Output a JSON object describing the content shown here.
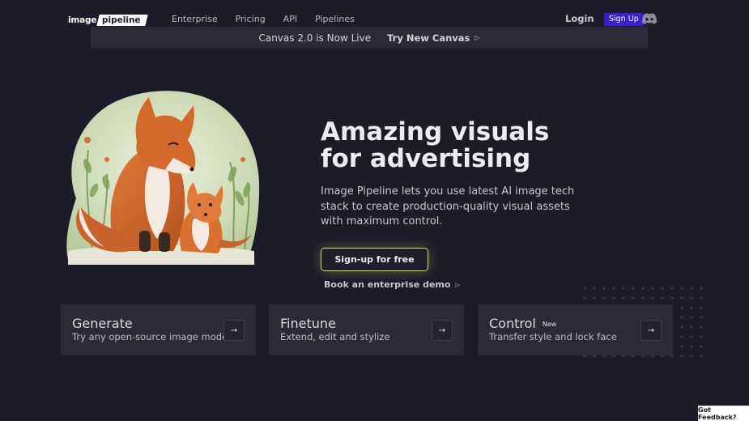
{
  "brand": {
    "logo_word1": "image",
    "logo_word2": "pipeline"
  },
  "nav": {
    "links": [
      "Enterprise",
      "Pricing",
      "API",
      "Pipelines"
    ],
    "login": "Login",
    "signup": "Sign Up",
    "discord_icon": "discord-icon"
  },
  "banner": {
    "text": "Canvas 2.0 is Now Live",
    "link": "Try New Canvas",
    "arrow": "▷"
  },
  "hero": {
    "title": "Amazing visuals for advertising",
    "description": "Image Pipeline lets you use latest AI image tech stack to create production-quality visual assets with maximum control.",
    "cta": "Sign-up for free",
    "demo_link": "Book an enterprise demo",
    "demo_arrow": "▷"
  },
  "cards": [
    {
      "title": "Generate",
      "subtitle": "Try any open-source image models",
      "badge": "",
      "arrow": "→"
    },
    {
      "title": "Finetune",
      "subtitle": "Extend, edit and stylize",
      "badge": "",
      "arrow": "→"
    },
    {
      "title": "Control",
      "subtitle": "Transfer style and lock face",
      "badge": "New",
      "arrow": "→"
    }
  ],
  "feedback": "Got Feedback?",
  "colors": {
    "background": "#1c1b29",
    "card": "#2b2a37",
    "accent_purple": "#3b1fcf",
    "cta_glow": "#c8e85a"
  }
}
